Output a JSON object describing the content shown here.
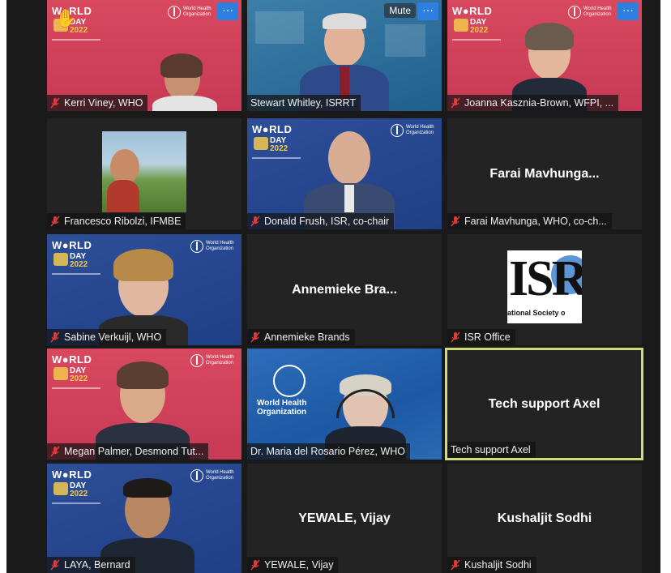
{
  "controls": {
    "mute_label": "Mute",
    "more_glyph": "···"
  },
  "badge": {
    "world": "W●RLD",
    "day": "DAY",
    "year": "2022"
  },
  "who": {
    "org_text": "World Health Organization"
  },
  "tiles": [
    {
      "name": "Kerri Viney, WHO",
      "muted": true
    },
    {
      "name": "Stewart Whitley, ISRRT",
      "muted": false
    },
    {
      "name": "Joanna Kasznia-Brown, WFPI, ...",
      "muted": true
    },
    {
      "name": "Francesco Ribolzi, IFMBE",
      "muted": true
    },
    {
      "name": "Donald Frush, ISR, co-chair",
      "muted": true
    },
    {
      "name": "Farai Mavhunga, WHO, co-ch...",
      "muted": true,
      "center": "Farai  Mavhunga..."
    },
    {
      "name": "Sabine Verkuijl, WHO",
      "muted": true
    },
    {
      "name": "Annemieke Brands",
      "muted": true,
      "center": "Annemieke  Bra..."
    },
    {
      "name": "ISR Office",
      "muted": true
    },
    {
      "name": "Megan Palmer, Desmond Tut...",
      "muted": true
    },
    {
      "name": "Dr. Maria del Rosario Pérez, WHO",
      "muted": false
    },
    {
      "name": "Tech support Axel",
      "muted": false,
      "center": "Tech support Axel"
    },
    {
      "name": "LAYA, Bernard",
      "muted": true
    },
    {
      "name": "YEWALE, Vijay",
      "muted": true,
      "center": "YEWALE, Vijay"
    },
    {
      "name": "Kushaljit Sodhi",
      "muted": true,
      "center": "Kushaljit Sodhi"
    }
  ],
  "isr_logo": {
    "letters": "ISR",
    "subtitle": "ational Society o"
  },
  "colors": {
    "active_border": "#cfdc7a",
    "mute_red": "#e03b3b",
    "more_blue": "#2d7fe0"
  }
}
